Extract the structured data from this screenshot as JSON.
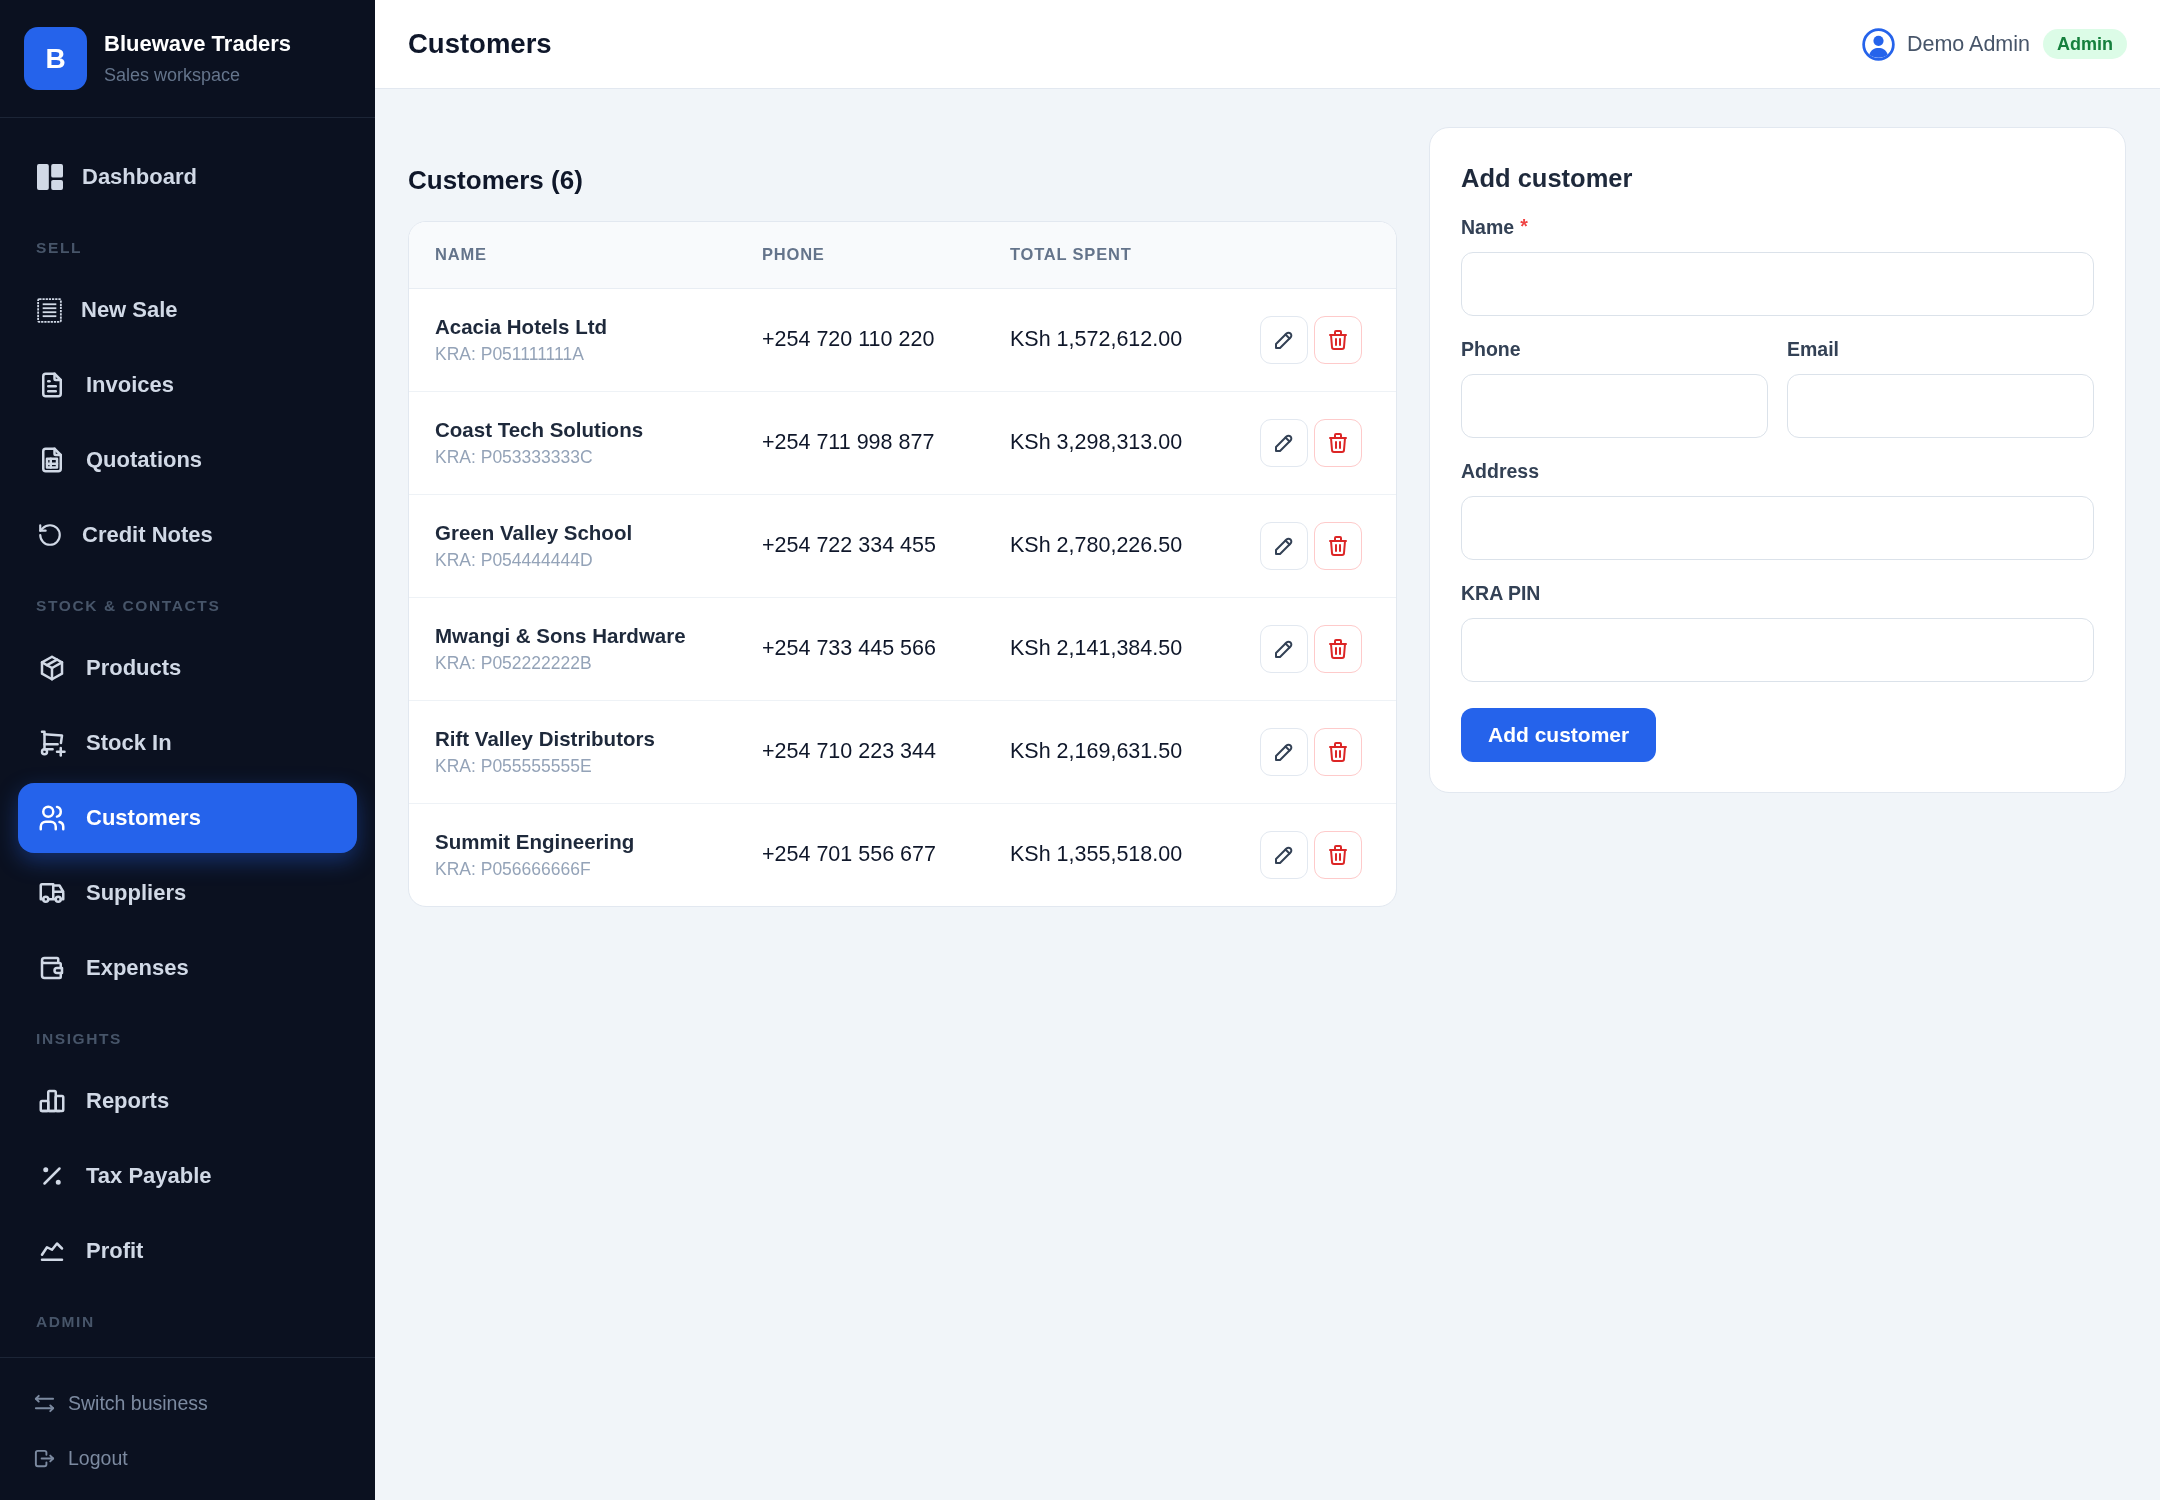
{
  "sidebar": {
    "brand": {
      "logo_letter": "B",
      "name": "Bluewave Traders",
      "subtitle": "Sales workspace"
    },
    "sections": [
      {
        "items": [
          {
            "label": "Dashboard",
            "selected": false
          }
        ]
      },
      {
        "label": "SELL",
        "items": [
          {
            "label": "New Sale",
            "selected": false
          },
          {
            "label": "Invoices",
            "selected": false
          },
          {
            "label": "Quotations",
            "selected": false
          },
          {
            "label": "Credit Notes",
            "selected": false
          }
        ]
      },
      {
        "label": "STOCK & CONTACTS",
        "items": [
          {
            "label": "Products",
            "selected": false
          },
          {
            "label": "Stock In",
            "selected": false
          },
          {
            "label": "Customers",
            "selected": true
          },
          {
            "label": "Suppliers",
            "selected": false
          },
          {
            "label": "Expenses",
            "selected": false
          }
        ]
      },
      {
        "label": "INSIGHTS",
        "items": [
          {
            "label": "Reports",
            "selected": false
          },
          {
            "label": "Tax Payable",
            "selected": false
          },
          {
            "label": "Profit",
            "selected": false
          }
        ]
      },
      {
        "label": "ADMIN"
      }
    ],
    "footer_links": [
      "Switch business",
      "Logout"
    ]
  },
  "header": {
    "title": "Customers",
    "user": {
      "name": "Demo Admin",
      "role": "Admin"
    }
  },
  "customers_table": {
    "title": "Customers (6)",
    "columns": [
      "NAME",
      "PHONE",
      "TOTAL SPENT"
    ],
    "rows": [
      {
        "name": "Acacia Hotels Ltd",
        "kra": "KRA: P051111111A",
        "phone": "+254 720 110 220",
        "total_spent": "KSh 1,572,612.00"
      },
      {
        "name": "Coast Tech Solutions",
        "kra": "KRA: P053333333C",
        "phone": "+254 711 998 877",
        "total_spent": "KSh 3,298,313.00"
      },
      {
        "name": "Green Valley School",
        "kra": "KRA: P054444444D",
        "phone": "+254 722 334 455",
        "total_spent": "KSh 2,780,226.50"
      },
      {
        "name": "Mwangi & Sons Hardware",
        "kra": "KRA: P052222222B",
        "phone": "+254 733 445 566",
        "total_spent": "KSh 2,141,384.50"
      },
      {
        "name": "Rift Valley Distributors",
        "kra": "KRA: P055555555E",
        "phone": "+254 710 223 344",
        "total_spent": "KSh 2,169,631.50"
      },
      {
        "name": "Summit Engineering",
        "kra": "KRA: P056666666F",
        "phone": "+254 701 556 677",
        "total_spent": "KSh 1,355,518.00"
      }
    ]
  },
  "add_customer_form": {
    "title": "Add customer",
    "rows": [
      {
        "fields": [
          {
            "label": "Name",
            "required_mark": "*"
          }
        ]
      },
      {
        "fields": [
          {
            "label": "Phone"
          },
          {
            "label": "Email"
          }
        ]
      },
      {
        "fields": [
          {
            "label": "Address"
          }
        ]
      },
      {
        "fields": [
          {
            "label": "KRA PIN"
          }
        ]
      }
    ],
    "submit": "Add customer"
  }
}
